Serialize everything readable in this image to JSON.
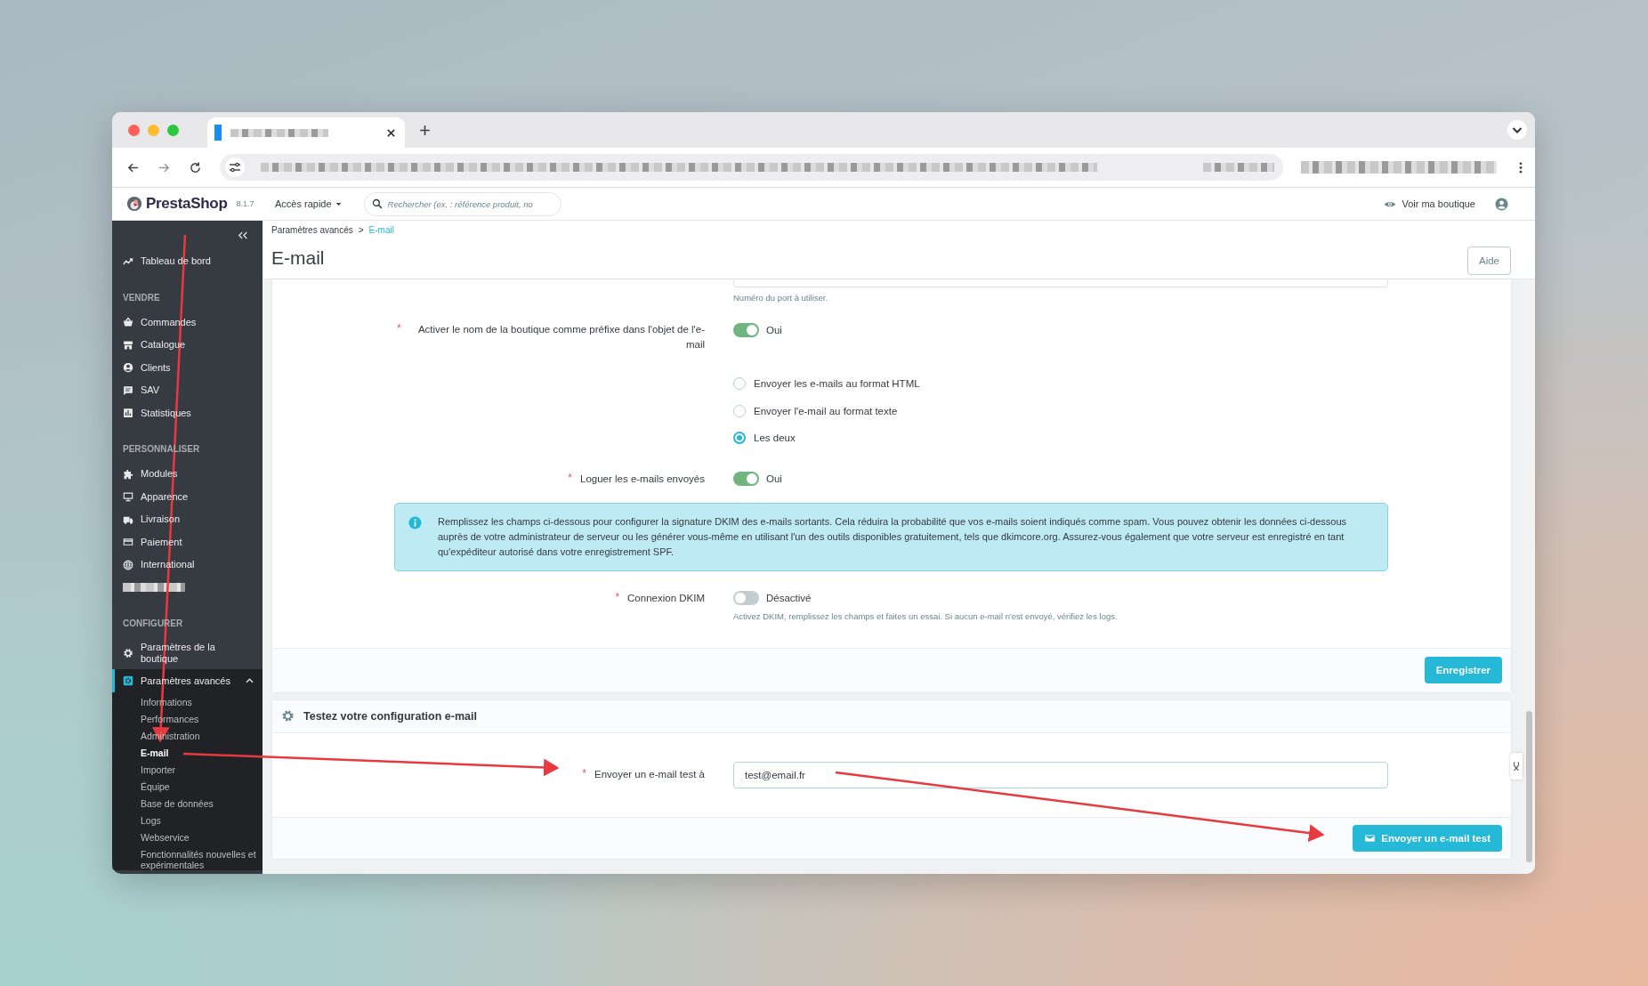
{
  "header": {
    "logo": "PrestaShop",
    "version": "8.1.7",
    "quick_access": "Accès rapide",
    "search": {
      "placeholder": "Rechercher (ex. : référence produit, no"
    },
    "view_shop": "Voir ma boutique"
  },
  "sidebar": {
    "sections": [
      {
        "items": [
          {
            "kind": "link",
            "label": "Tableau de bord",
            "selected": false
          }
        ]
      },
      {
        "heading": "VENDRE",
        "items": [
          {
            "kind": "link",
            "label": "Commandes",
            "selected": false
          },
          {
            "kind": "link",
            "label": "Catalogue",
            "selected": false
          },
          {
            "kind": "link",
            "label": "Clients",
            "selected": false
          },
          {
            "kind": "link",
            "label": "SAV",
            "selected": false
          },
          {
            "kind": "link",
            "label": "Statistiques",
            "selected": false
          }
        ]
      },
      {
        "heading": "PERSONNALISER",
        "items": [
          {
            "kind": "link",
            "label": "Modules",
            "selected": false
          },
          {
            "kind": "link",
            "label": "Apparence",
            "selected": false
          },
          {
            "kind": "link",
            "label": "Livraison",
            "selected": false
          },
          {
            "kind": "link",
            "label": "Paiement",
            "selected": false
          },
          {
            "kind": "link",
            "label": "International",
            "selected": false
          },
          {
            "kind": "redacted"
          }
        ]
      },
      {
        "heading": "CONFIGURER",
        "items": [
          {
            "kind": "link",
            "label": "Paramètres de la boutique",
            "selected": false
          },
          {
            "kind": "link",
            "label": "Paramètres avancés",
            "selected": true,
            "expanded": true,
            "children": [
              {
                "label": "Informations",
                "selected": false
              },
              {
                "label": "Performances",
                "selected": false
              },
              {
                "label": "Administration",
                "selected": false
              },
              {
                "label": "E-mail",
                "selected": true
              },
              {
                "label": "Importer",
                "selected": false
              },
              {
                "label": "Équipe",
                "selected": false
              },
              {
                "label": "Base de données",
                "selected": false
              },
              {
                "label": "Logs",
                "selected": false
              },
              {
                "label": "Webservice",
                "selected": false
              },
              {
                "label": "Fonctionnalités nouvelles et expérimentales",
                "selected": false
              }
            ]
          }
        ]
      }
    ]
  },
  "breadcrumb": {
    "items": [
      "Paramètres avancés",
      "E-mail"
    ],
    "separator": ">"
  },
  "page_title": "E-mail",
  "help_button": "Aide",
  "settings_card": {
    "port_hint": "Numéro du port à utiliser.",
    "fields": [
      {
        "kind": "switch",
        "marker": "*",
        "label": "Activer le nom de la boutique comme préfixe dans l'objet de l'e-mail",
        "on": true,
        "state_text": "Oui"
      },
      {
        "kind": "radio",
        "options": [
          {
            "label": "Envoyer les e-mails au format HTML",
            "selected": false
          },
          {
            "label": "Envoyer l'e-mail au format texte",
            "selected": false
          },
          {
            "label": "Les deux",
            "selected": true
          }
        ]
      },
      {
        "kind": "switch",
        "marker": "*",
        "label": "Loguer les e-mails envoyés",
        "on": true,
        "state_text": "Oui"
      },
      {
        "kind": "info",
        "text": "Remplissez les champs ci-dessous pour configurer la signature DKIM des e-mails sortants. Cela réduira la probabilité que vos e-mails soient indiqués comme spam. Vous pouvez obtenir les données ci-dessous auprès de votre administrateur de serveur ou les générer vous-même en utilisant l'un des outils disponibles gratuitement, tels que dkimcore.org. Assurez-vous également que votre serveur est enregistré en tant qu'expéditeur autorisé dans votre enregistrement SPF."
      },
      {
        "kind": "switch",
        "marker": "*",
        "label": "Connexion DKIM",
        "on": false,
        "state_text": "Désactivé",
        "hint": "Activez DKIM, remplissez les champs et faites un essai. Si aucun e-mail n'est envoyé, vérifiez les logs."
      }
    ],
    "save_button": "Enregistrer"
  },
  "test_card": {
    "title": "Testez votre configuration e-mail",
    "marker": "*",
    "label": "Envoyer un e-mail test à",
    "value": "test@email.fr",
    "send_button": "Envoyer un e-mail test"
  }
}
